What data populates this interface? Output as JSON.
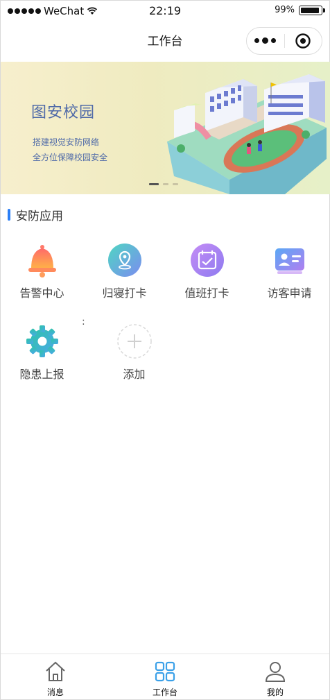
{
  "status_bar": {
    "carrier": "WeChat",
    "time": "22:19",
    "battery": "99%"
  },
  "nav": {
    "title": "工作台"
  },
  "banner": {
    "title": "图安校园",
    "line1": "搭建视觉安防网络",
    "line2": "全方位保障校园安全",
    "slides": 3,
    "active_slide": 1
  },
  "section": {
    "title": "安防应用"
  },
  "apps": [
    {
      "label": "告警中心",
      "icon": "bell-icon"
    },
    {
      "label": "归寝打卡",
      "icon": "location-pin-icon"
    },
    {
      "label": "值班打卡",
      "icon": "calendar-check-icon"
    },
    {
      "label": "访客申请",
      "icon": "id-card-icon"
    },
    {
      "label": "隐患上报",
      "icon": "gear-icon"
    },
    {
      "label": "添加",
      "icon": "add-icon"
    }
  ],
  "stray_text": ":",
  "tabs": [
    {
      "label": "消息",
      "icon": "home-icon",
      "active": false
    },
    {
      "label": "工作台",
      "icon": "grid-icon",
      "active": true
    },
    {
      "label": "我的",
      "icon": "user-icon",
      "active": false
    }
  ],
  "colors": {
    "accent": "#2b7ff6",
    "active_tab": "#3aa0e8",
    "banner_text": "#4f6aa8"
  }
}
